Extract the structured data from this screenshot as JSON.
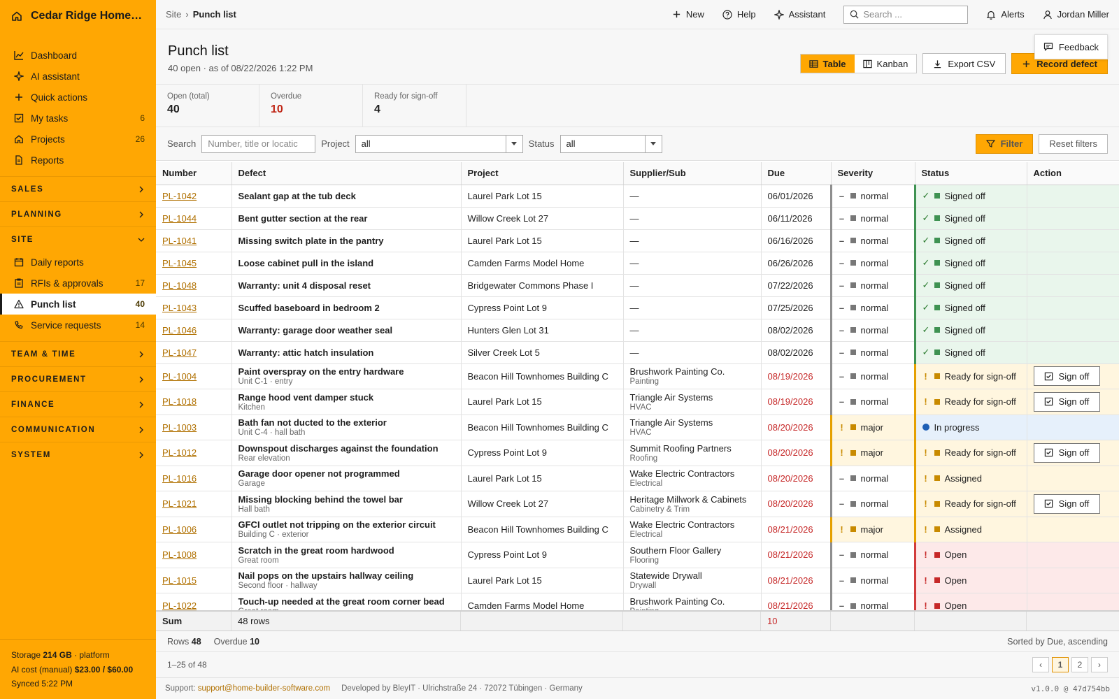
{
  "brand": {
    "name": "Cedar Ridge Homes L...",
    "accent": "#ffa703"
  },
  "sidebar": {
    "items": [
      {
        "label": "Dashboard",
        "icon": "chart-line-icon",
        "count": ""
      },
      {
        "label": "AI assistant",
        "icon": "sparkle-icon",
        "count": ""
      },
      {
        "label": "Quick actions",
        "icon": "plus-icon",
        "count": ""
      },
      {
        "label": "My tasks",
        "icon": "checkbox-icon",
        "count": "6"
      },
      {
        "label": "Projects",
        "icon": "home-icon",
        "count": "26"
      },
      {
        "label": "Reports",
        "icon": "document-icon",
        "count": ""
      }
    ],
    "sections": [
      "SALES",
      "PLANNING",
      "SITE",
      "TEAM & TIME",
      "PROCUREMENT",
      "FINANCE",
      "COMMUNICATION",
      "SYSTEM"
    ],
    "site_items": [
      {
        "label": "Daily reports",
        "icon": "calendar-icon",
        "count": ""
      },
      {
        "label": "RFIs & approvals",
        "icon": "clipboard-icon",
        "count": "17"
      },
      {
        "label": "Punch list",
        "icon": "warning-icon",
        "count": "40",
        "active": true
      },
      {
        "label": "Service requests",
        "icon": "phone-icon",
        "count": "14"
      }
    ],
    "footer": {
      "storage_label": "Storage",
      "storage_value": "214 GB",
      "storage_suffix": "· platform",
      "ai_label": "AI cost (manual)",
      "ai_value": "$23.00 / $60.00",
      "synced": "Synced 5:22 PM"
    }
  },
  "topbar": {
    "crumb_root": "Site",
    "crumb_sep": "›",
    "crumb_current": "Punch list",
    "new_label": "New",
    "help_label": "Help",
    "assistant_label": "Assistant",
    "search_placeholder": "Search ...",
    "alerts_label": "Alerts",
    "user_name": "Jordan Miller"
  },
  "page": {
    "title": "Punch list",
    "subtitle": "40 open · as of 08/22/2026 1:22 PM",
    "view_table": "Table",
    "view_kanban": "Kanban",
    "export_label": "Export CSV",
    "record_label": "Record defect",
    "feedback_label": "Feedback"
  },
  "kpis": [
    {
      "label": "Open (total)",
      "value": "40",
      "red": false
    },
    {
      "label": "Overdue",
      "value": "10",
      "red": true
    },
    {
      "label": "Ready for sign-off",
      "value": "4",
      "red": false
    }
  ],
  "filters": {
    "search_label": "Search",
    "search_placeholder": "Number, title or locatic",
    "project_label": "Project",
    "project_value": "all",
    "status_label": "Status",
    "status_value": "all",
    "filter_label": "Filter",
    "reset_label": "Reset filters"
  },
  "table": {
    "columns": [
      "Number",
      "Defect",
      "Project",
      "Supplier/Sub",
      "Due",
      "Severity",
      "Status",
      "Action"
    ],
    "signoff_label": "Sign off",
    "rows": [
      {
        "num": "PL-1042",
        "title": "Sealant gap at the tub deck",
        "sub": "",
        "project": "Laurel Park Lot 15",
        "supplier": "—",
        "trade": "",
        "due": "06/01/2026",
        "overdue": false,
        "severity": "normal",
        "status": "Signed off",
        "kind": "signed",
        "action": false
      },
      {
        "num": "PL-1044",
        "title": "Bent gutter section at the rear",
        "sub": "",
        "project": "Willow Creek Lot 27",
        "supplier": "—",
        "trade": "",
        "due": "06/11/2026",
        "overdue": false,
        "severity": "normal",
        "status": "Signed off",
        "kind": "signed",
        "action": false
      },
      {
        "num": "PL-1041",
        "title": "Missing switch plate in the pantry",
        "sub": "",
        "project": "Laurel Park Lot 15",
        "supplier": "—",
        "trade": "",
        "due": "06/16/2026",
        "overdue": false,
        "severity": "normal",
        "status": "Signed off",
        "kind": "signed",
        "action": false
      },
      {
        "num": "PL-1045",
        "title": "Loose cabinet pull in the island",
        "sub": "",
        "project": "Camden Farms Model Home",
        "supplier": "—",
        "trade": "",
        "due": "06/26/2026",
        "overdue": false,
        "severity": "normal",
        "status": "Signed off",
        "kind": "signed",
        "action": false
      },
      {
        "num": "PL-1048",
        "title": "Warranty: unit 4 disposal reset",
        "sub": "",
        "project": "Bridgewater Commons Phase I",
        "supplier": "—",
        "trade": "",
        "due": "07/22/2026",
        "overdue": false,
        "severity": "normal",
        "status": "Signed off",
        "kind": "signed",
        "action": false
      },
      {
        "num": "PL-1043",
        "title": "Scuffed baseboard in bedroom 2",
        "sub": "",
        "project": "Cypress Point Lot 9",
        "supplier": "—",
        "trade": "",
        "due": "07/25/2026",
        "overdue": false,
        "severity": "normal",
        "status": "Signed off",
        "kind": "signed",
        "action": false
      },
      {
        "num": "PL-1046",
        "title": "Warranty: garage door weather seal",
        "sub": "",
        "project": "Hunters Glen Lot 31",
        "supplier": "—",
        "trade": "",
        "due": "08/02/2026",
        "overdue": false,
        "severity": "normal",
        "status": "Signed off",
        "kind": "signed",
        "action": false
      },
      {
        "num": "PL-1047",
        "title": "Warranty: attic hatch insulation",
        "sub": "",
        "project": "Silver Creek Lot 5",
        "supplier": "—",
        "trade": "",
        "due": "08/02/2026",
        "overdue": false,
        "severity": "normal",
        "status": "Signed off",
        "kind": "signed",
        "action": false
      },
      {
        "num": "PL-1004",
        "title": "Paint overspray on the entry hardware",
        "sub": "Unit C-1 · entry",
        "project": "Beacon Hill Townhomes Building C",
        "supplier": "Brushwork Painting Co.",
        "trade": "Painting",
        "due": "08/19/2026",
        "overdue": true,
        "severity": "normal",
        "status": "Ready for sign-off",
        "kind": "ready",
        "action": true
      },
      {
        "num": "PL-1018",
        "title": "Range hood vent damper stuck",
        "sub": "Kitchen",
        "project": "Laurel Park Lot 15",
        "supplier": "Triangle Air Systems",
        "trade": "HVAC",
        "due": "08/19/2026",
        "overdue": true,
        "severity": "normal",
        "status": "Ready for sign-off",
        "kind": "ready",
        "action": true
      },
      {
        "num": "PL-1003",
        "title": "Bath fan not ducted to the exterior",
        "sub": "Unit C-4 · hall bath",
        "project": "Beacon Hill Townhomes Building C",
        "supplier": "Triangle Air Systems",
        "trade": "HVAC",
        "due": "08/20/2026",
        "overdue": true,
        "severity": "major",
        "status": "In progress",
        "kind": "inprog",
        "action": false
      },
      {
        "num": "PL-1012",
        "title": "Downspout discharges against the foundation",
        "sub": "Rear elevation",
        "project": "Cypress Point Lot 9",
        "supplier": "Summit Roofing Partners",
        "trade": "Roofing",
        "due": "08/20/2026",
        "overdue": true,
        "severity": "major",
        "status": "Ready for sign-off",
        "kind": "ready",
        "action": true
      },
      {
        "num": "PL-1016",
        "title": "Garage door opener not programmed",
        "sub": "Garage",
        "project": "Laurel Park Lot 15",
        "supplier": "Wake Electric Contractors",
        "trade": "Electrical",
        "due": "08/20/2026",
        "overdue": true,
        "severity": "normal",
        "status": "Assigned",
        "kind": "assigned",
        "action": false
      },
      {
        "num": "PL-1021",
        "title": "Missing blocking behind the towel bar",
        "sub": "Hall bath",
        "project": "Willow Creek Lot 27",
        "supplier": "Heritage Millwork & Cabinets",
        "trade": "Cabinetry & Trim",
        "due": "08/20/2026",
        "overdue": true,
        "severity": "normal",
        "status": "Ready for sign-off",
        "kind": "ready",
        "action": true
      },
      {
        "num": "PL-1006",
        "title": "GFCI outlet not tripping on the exterior circuit",
        "sub": "Building C · exterior",
        "project": "Beacon Hill Townhomes Building C",
        "supplier": "Wake Electric Contractors",
        "trade": "Electrical",
        "due": "08/21/2026",
        "overdue": true,
        "severity": "major",
        "status": "Assigned",
        "kind": "assigned",
        "action": false
      },
      {
        "num": "PL-1008",
        "title": "Scratch in the great room hardwood",
        "sub": "Great room",
        "project": "Cypress Point Lot 9",
        "supplier": "Southern Floor Gallery",
        "trade": "Flooring",
        "due": "08/21/2026",
        "overdue": true,
        "severity": "normal",
        "status": "Open",
        "kind": "open",
        "action": false
      },
      {
        "num": "PL-1015",
        "title": "Nail pops on the upstairs hallway ceiling",
        "sub": "Second floor · hallway",
        "project": "Laurel Park Lot 15",
        "supplier": "Statewide Drywall",
        "trade": "Drywall",
        "due": "08/21/2026",
        "overdue": true,
        "severity": "normal",
        "status": "Open",
        "kind": "open",
        "action": false
      },
      {
        "num": "PL-1022",
        "title": "Touch-up needed at the great room corner bead",
        "sub": "Great room",
        "project": "Camden Farms Model Home",
        "supplier": "Brushwork Painting Co.",
        "trade": "Painting",
        "due": "08/21/2026",
        "overdue": true,
        "severity": "normal",
        "status": "Open",
        "kind": "open",
        "action": false
      }
    ]
  },
  "summary": {
    "label": "Sum",
    "rows_text": "48 rows",
    "overdue": "10"
  },
  "statusbar": {
    "rows_label": "Rows",
    "rows_value": "48",
    "overdue_label": "Overdue",
    "overdue_value": "10",
    "sorted": "Sorted by Due, ascending"
  },
  "pager": {
    "range": "1–25 of 48",
    "prev": "‹",
    "pages": [
      "1",
      "2"
    ],
    "next": "›"
  },
  "footer": {
    "support_label": "Support:",
    "support_email": "support@home-builder-software.com",
    "developer": "Developed by BleyIT · Ulrichstraße 24 · 72072 Tübingen · Germany",
    "version": "v1.0.0 @ 47d754bb"
  }
}
